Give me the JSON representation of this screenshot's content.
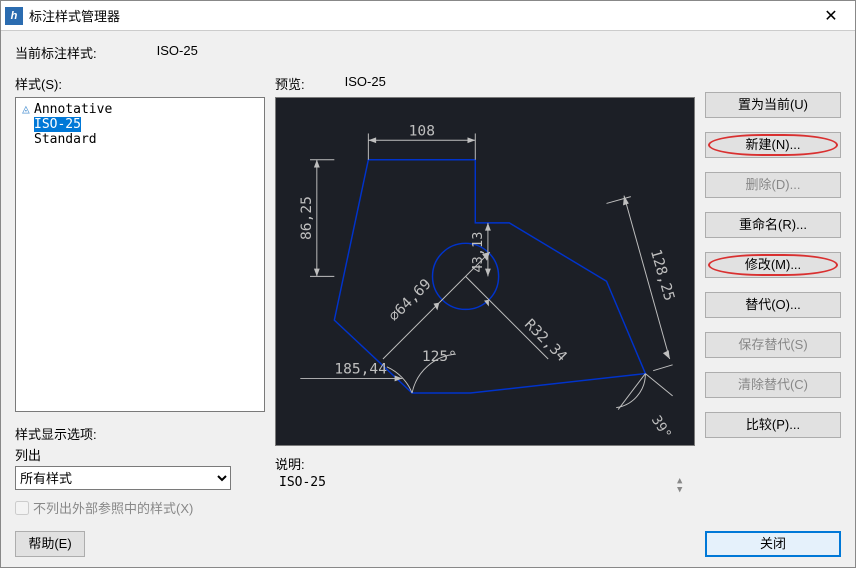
{
  "window": {
    "title": "标注样式管理器"
  },
  "current_style": {
    "label": "当前标注样式:",
    "value": "ISO-25"
  },
  "styles_section_label": "样式(S):",
  "styles": [
    {
      "name": "Annotative",
      "annotative": true,
      "selected": false
    },
    {
      "name": "ISO-25",
      "annotative": false,
      "selected": true
    },
    {
      "name": "Standard",
      "annotative": false,
      "selected": false
    }
  ],
  "display_options": {
    "title": "样式显示选项:",
    "list_label": "列出",
    "dropdown_value": "所有样式",
    "checkbox_label": "不列出外部参照中的样式(X)",
    "checkbox_checked": false
  },
  "preview": {
    "label": "预览:",
    "value": "ISO-25",
    "dimensions": {
      "d108": "108",
      "d8625": "86,25",
      "d4313": "43,13",
      "d12825": "128,25",
      "d6469": "∅64,69",
      "d3234": "R32,34",
      "d125deg": "125°",
      "d18544": "185,44",
      "d39deg": "39°"
    }
  },
  "description": {
    "label": "说明:",
    "value": "ISO-25"
  },
  "buttons": {
    "set_current": "置为当前(U)",
    "new": "新建(N)...",
    "delete": "删除(D)...",
    "rename": "重命名(R)...",
    "modify": "修改(M)...",
    "override": "替代(O)...",
    "save_override": "保存替代(S)",
    "clear_override": "清除替代(C)",
    "compare": "比较(P)...",
    "help": "帮助(E)",
    "close": "关闭"
  }
}
